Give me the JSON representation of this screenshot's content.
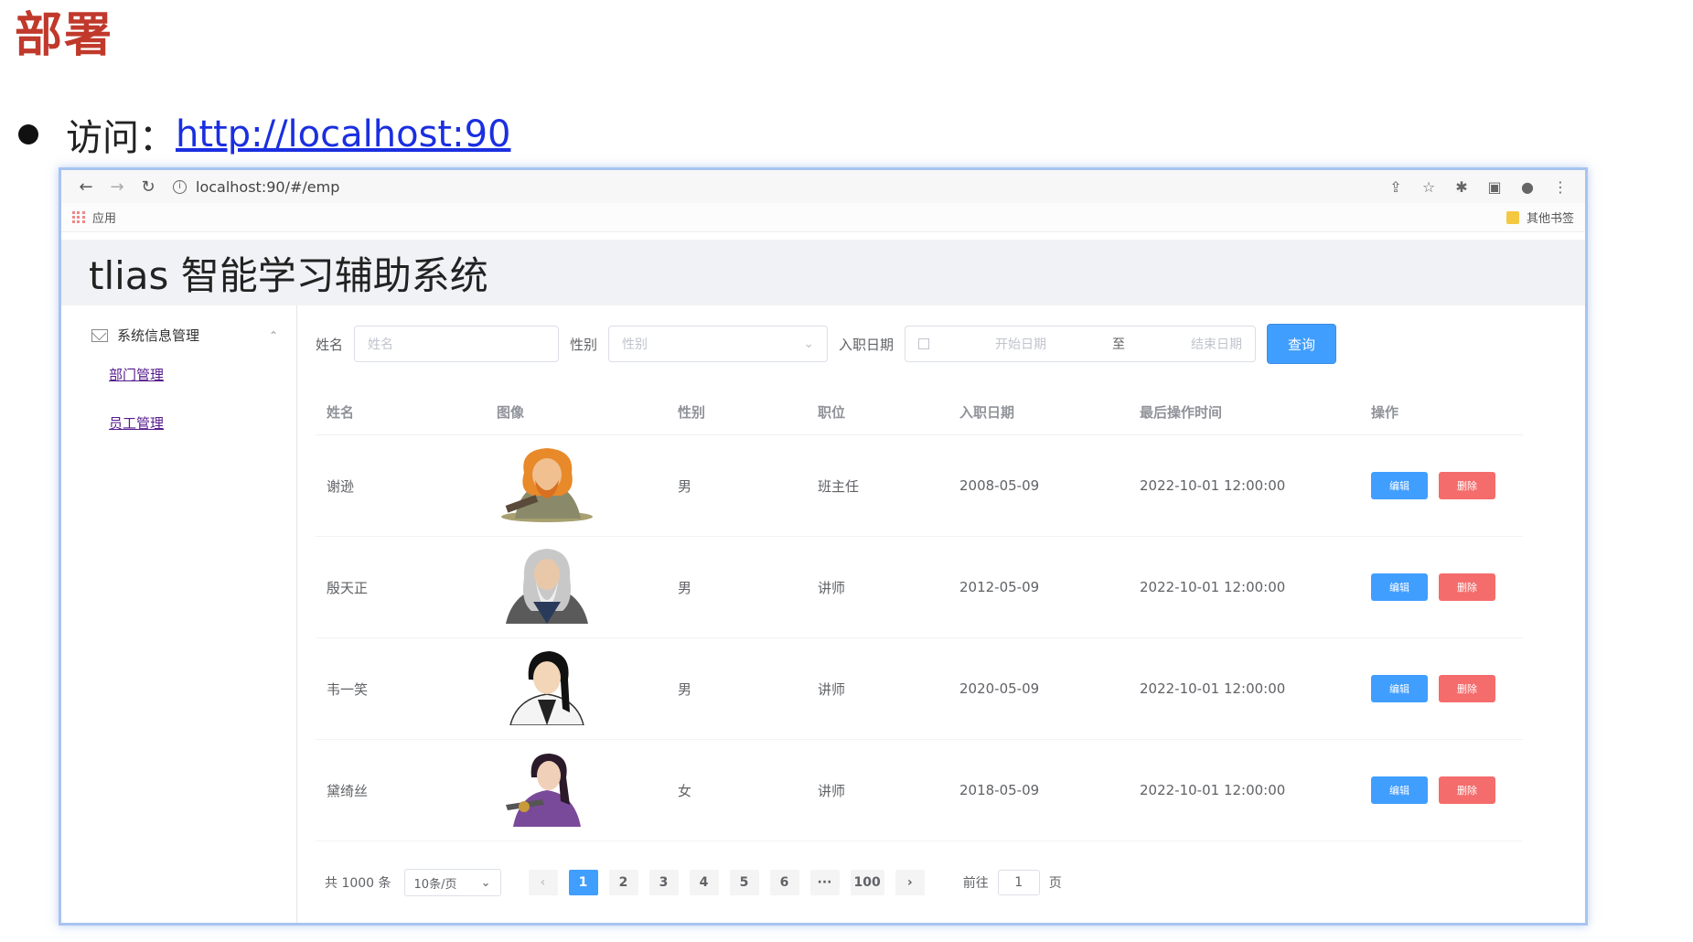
{
  "slide": {
    "title": "部署",
    "bullet_label": "访问：",
    "bullet_link": "http://localhost:90"
  },
  "browser": {
    "url": "localhost:90/#/emp",
    "apps_label": "应用",
    "other_bookmarks": "其他书签"
  },
  "app": {
    "title": "tlias 智能学习辅助系统"
  },
  "sidebar": {
    "group_label": "系统信息管理",
    "items": [
      {
        "label": "部门管理"
      },
      {
        "label": "员工管理"
      }
    ]
  },
  "filters": {
    "name_label": "姓名",
    "name_placeholder": "姓名",
    "gender_label": "性别",
    "gender_placeholder": "性别",
    "entry_label": "入职日期",
    "start_placeholder": "开始日期",
    "range_sep": "至",
    "end_placeholder": "结束日期",
    "query_label": "查询"
  },
  "table": {
    "headers": [
      "姓名",
      "图像",
      "性别",
      "职位",
      "入职日期",
      "最后操作时间",
      "操作"
    ],
    "edit_label": "编辑",
    "delete_label": "删除",
    "rows": [
      {
        "name": "谢逊",
        "gender": "男",
        "job": "班主任",
        "entry": "2008-05-09",
        "update": "2022-10-01 12:00:00",
        "avatar": "orange-haired-man"
      },
      {
        "name": "殷天正",
        "gender": "男",
        "job": "讲师",
        "entry": "2012-05-09",
        "update": "2022-10-01 12:00:00",
        "avatar": "grey-haired-elder"
      },
      {
        "name": "韦一笑",
        "gender": "男",
        "job": "讲师",
        "entry": "2020-05-09",
        "update": "2022-10-01 12:00:00",
        "avatar": "black-haired-man"
      },
      {
        "name": "黛绮丝",
        "gender": "女",
        "job": "讲师",
        "entry": "2018-05-09",
        "update": "2022-10-01 12:00:00",
        "avatar": "purple-robed-woman"
      }
    ]
  },
  "pagination": {
    "total": "共 1000 条",
    "page_size": "10条/页",
    "pages": [
      "1",
      "2",
      "3",
      "4",
      "5",
      "6",
      "···",
      "100"
    ],
    "current_page": "1",
    "goto_label": "前往",
    "goto_value": "1",
    "goto_suffix": "页"
  },
  "colors": {
    "primary": "#409eff",
    "danger": "#f56c6c",
    "slide_title": "#c0392b",
    "link": "#1a2fe0"
  }
}
